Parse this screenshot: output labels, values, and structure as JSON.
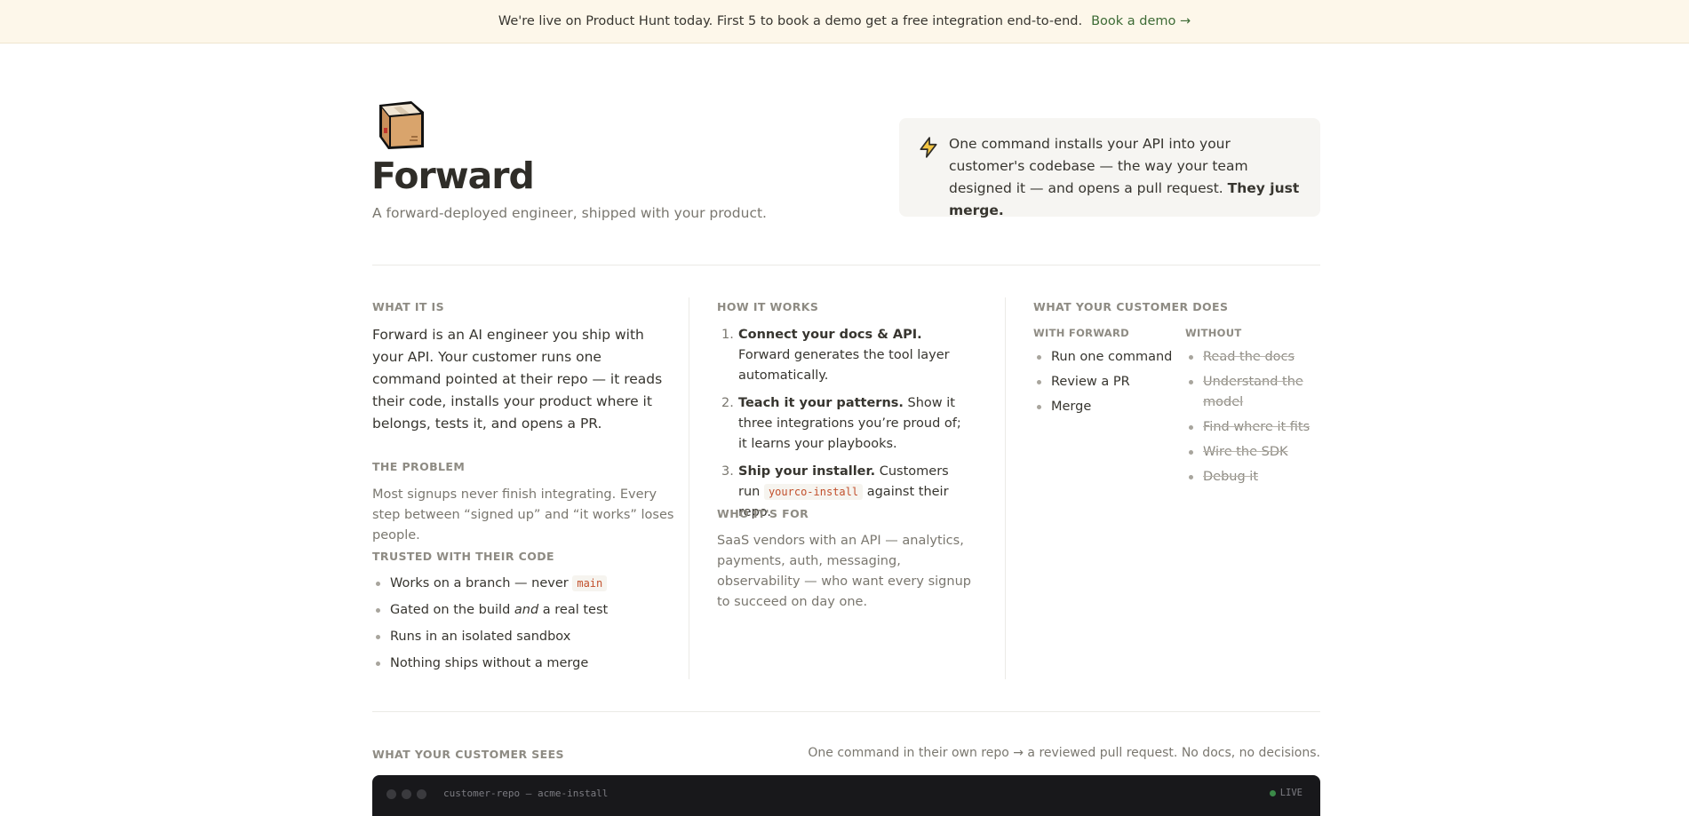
{
  "banner": {
    "message": "We're live on Product Hunt today. First 5 to book a demo get a free integration end-to-end.",
    "cta": "Book a demo →"
  },
  "hero": {
    "logo_icon": "package-box-icon",
    "title": "Forward",
    "subtitle": "A forward-deployed engineer, shipped with your product."
  },
  "callout": {
    "icon": "lightning-bolt-icon",
    "text": "One command installs your API into your customer's codebase — the way your team designed it — and opens a pull request.",
    "emphasis": "They just merge."
  },
  "what_it_is": {
    "label": "WHAT IT IS",
    "body": "Forward is an AI engineer you ship with your API. Your customer runs one command pointed at their repo — it reads their code, installs your product where it belongs, tests it, and opens a PR."
  },
  "problem": {
    "label": "THE PROBLEM",
    "body": "Most signups never finish integrating. Every step between “signed up” and “it works” loses people."
  },
  "trusted": {
    "label": "TRUSTED WITH THEIR CODE",
    "item1_text": "Works on a branch — never",
    "item1_code": "main",
    "item2_pre": "Gated on the build",
    "item2_em": "and",
    "item2_post": "a real test",
    "item3": "Runs in an isolated sandbox",
    "item4": "Nothing ships without a merge"
  },
  "how_it_works": {
    "label": "HOW IT WORKS",
    "steps": [
      {
        "num": "1.",
        "bold": "Connect your docs & API.",
        "text": " Forward generates the tool layer automatically."
      },
      {
        "num": "2.",
        "bold": "Teach it your patterns.",
        "text": " Show it three integrations you’re proud of; it learns your playbooks."
      },
      {
        "num": "3.",
        "bold": "Ship your installer.",
        "text_pre": " Customers run ",
        "code": "yourco-install",
        "text_post": " against their repo."
      }
    ]
  },
  "who_for": {
    "label": "WHO IT'S FOR",
    "body": "SaaS vendors with an API — analytics, payments, auth, messaging, observability — who want every signup to succeed on day one."
  },
  "customer_does": {
    "label": "WHAT YOUR CUSTOMER DOES",
    "with_label": "WITH FORWARD",
    "with_items": [
      "Run one command",
      "Review a PR",
      "Merge"
    ],
    "without_label": "WITHOUT",
    "without_items": [
      "Read the docs",
      "Understand the model",
      "Find where it fits",
      "Wire the SDK",
      "Debug it"
    ]
  },
  "sees": {
    "label": "WHAT YOUR CUSTOMER SEES",
    "right": "One command in their own repo → a reviewed pull request. No docs, no decisions."
  },
  "terminal": {
    "title": "customer-repo — acme-install",
    "status": "LIVE"
  },
  "colors": {
    "banner_bg": "#fdf7ea",
    "banner_link": "#3d6b35",
    "code_text": "#c2502c",
    "terminal_bg": "#18181b",
    "live_dot": "#3b8a48"
  }
}
